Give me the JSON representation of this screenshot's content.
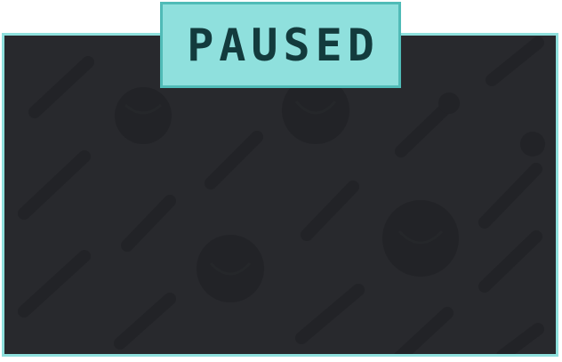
{
  "pause_screen": {
    "title": "PAUSED"
  },
  "colors": {
    "panel_background": "#28292d",
    "panel_border": "#8fe0dd",
    "banner_background": "#8fe0dd",
    "banner_border": "#50bbb7",
    "title_text": "#133b3d",
    "pattern_shapes": "#222327"
  },
  "background_pattern": {
    "icons": [
      "capsule-icon",
      "ball-icon",
      "bolt-icon"
    ]
  }
}
